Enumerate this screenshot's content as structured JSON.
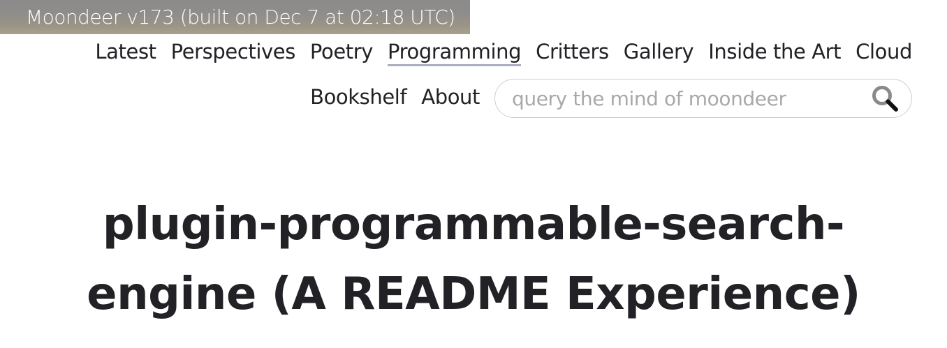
{
  "banner": {
    "build_text": "Moondeer v173 (built on Dec 7 at 02:18 UTC)"
  },
  "nav": {
    "row1": [
      {
        "label": "Latest",
        "active": false
      },
      {
        "label": "Perspectives",
        "active": false
      },
      {
        "label": "Poetry",
        "active": false
      },
      {
        "label": "Programming",
        "active": true
      },
      {
        "label": "Critters",
        "active": false
      },
      {
        "label": "Gallery",
        "active": false
      },
      {
        "label": "Inside the Art",
        "active": false
      },
      {
        "label": "Cloud",
        "active": false
      }
    ],
    "row2": [
      {
        "label": "Bookshelf",
        "active": false
      },
      {
        "label": "About",
        "active": false
      }
    ],
    "active_underline_color": "#a9aec0"
  },
  "search": {
    "placeholder": "query the mind of moondeer",
    "value": "",
    "icon": "search-icon"
  },
  "article": {
    "title_line1": "plugin-programmable-search-",
    "title_line2": "engine (A README Experience)"
  },
  "colors": {
    "text": "#222226",
    "banner_text": "#ffffff",
    "placeholder": "#a8a8a8"
  }
}
